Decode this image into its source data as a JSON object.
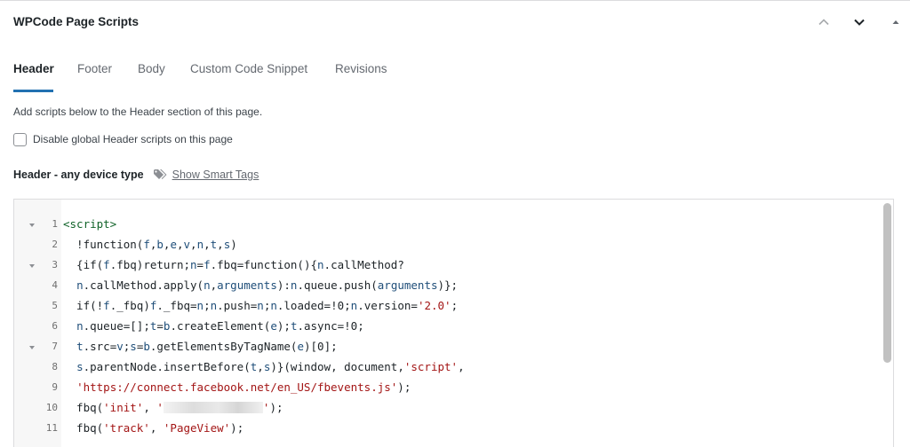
{
  "panel": {
    "title": "WPCode Page Scripts"
  },
  "tabs": [
    {
      "label": "Header",
      "active": true
    },
    {
      "label": "Footer",
      "active": false
    },
    {
      "label": "Body",
      "active": false
    },
    {
      "label": "Custom Code Snippet",
      "active": false
    },
    {
      "label": "Revisions",
      "active": false
    }
  ],
  "description": "Add scripts below to the Header section of this page.",
  "disable_checkbox": {
    "label": "Disable global Header scripts on this page",
    "checked": false
  },
  "field": {
    "label": "Header - any device type",
    "smart_tags_link": "Show Smart Tags"
  },
  "icons": {
    "move_up": "chevron-up-icon",
    "move_down": "chevron-down-icon",
    "toggle": "triangle-up-icon",
    "smart_tags": "tag-icon",
    "fold": "fold-arrow-icon"
  },
  "colors": {
    "accent": "#2271b1",
    "string": "#a31515",
    "tag": "#116329",
    "variable": "#1f4e79"
  },
  "editor": {
    "lines": [
      {
        "n": "1",
        "fold": true,
        "tokens": [
          {
            "t": "<script>",
            "c": "tag"
          }
        ]
      },
      {
        "n": "2",
        "fold": false,
        "tokens": [
          {
            "t": "  !function("
          },
          {
            "t": "f",
            "c": "var"
          },
          {
            "t": ","
          },
          {
            "t": "b",
            "c": "var"
          },
          {
            "t": ","
          },
          {
            "t": "e",
            "c": "var"
          },
          {
            "t": ","
          },
          {
            "t": "v",
            "c": "var"
          },
          {
            "t": ","
          },
          {
            "t": "n",
            "c": "var"
          },
          {
            "t": ","
          },
          {
            "t": "t",
            "c": "var"
          },
          {
            "t": ","
          },
          {
            "t": "s",
            "c": "var"
          },
          {
            "t": ")"
          }
        ]
      },
      {
        "n": "3",
        "fold": true,
        "tokens": [
          {
            "t": "  {if("
          },
          {
            "t": "f",
            "c": "var"
          },
          {
            "t": ".fbq)return;"
          },
          {
            "t": "n",
            "c": "var"
          },
          {
            "t": "="
          },
          {
            "t": "f",
            "c": "var"
          },
          {
            "t": ".fbq=function(){"
          },
          {
            "t": "n",
            "c": "var"
          },
          {
            "t": ".callMethod?"
          }
        ]
      },
      {
        "n": "4",
        "fold": false,
        "tokens": [
          {
            "t": "  "
          },
          {
            "t": "n",
            "c": "var"
          },
          {
            "t": ".callMethod.apply("
          },
          {
            "t": "n",
            "c": "var"
          },
          {
            "t": ","
          },
          {
            "t": "arguments",
            "c": "var"
          },
          {
            "t": "):"
          },
          {
            "t": "n",
            "c": "var"
          },
          {
            "t": ".queue.push("
          },
          {
            "t": "arguments",
            "c": "var"
          },
          {
            "t": ")};"
          }
        ]
      },
      {
        "n": "5",
        "fold": false,
        "tokens": [
          {
            "t": "  if(!"
          },
          {
            "t": "f",
            "c": "var"
          },
          {
            "t": "._fbq)"
          },
          {
            "t": "f",
            "c": "var"
          },
          {
            "t": "._fbq="
          },
          {
            "t": "n",
            "c": "var"
          },
          {
            "t": ";"
          },
          {
            "t": "n",
            "c": "var"
          },
          {
            "t": ".push="
          },
          {
            "t": "n",
            "c": "var"
          },
          {
            "t": ";"
          },
          {
            "t": "n",
            "c": "var"
          },
          {
            "t": ".loaded=!0;"
          },
          {
            "t": "n",
            "c": "var"
          },
          {
            "t": ".version="
          },
          {
            "t": "'2.0'",
            "c": "str"
          },
          {
            "t": ";"
          }
        ]
      },
      {
        "n": "6",
        "fold": false,
        "tokens": [
          {
            "t": "  "
          },
          {
            "t": "n",
            "c": "var"
          },
          {
            "t": ".queue=[];"
          },
          {
            "t": "t",
            "c": "var"
          },
          {
            "t": "="
          },
          {
            "t": "b",
            "c": "var"
          },
          {
            "t": ".createElement("
          },
          {
            "t": "e",
            "c": "var"
          },
          {
            "t": ");"
          },
          {
            "t": "t",
            "c": "var"
          },
          {
            "t": ".async=!0;"
          }
        ]
      },
      {
        "n": "7",
        "fold": true,
        "tokens": [
          {
            "t": "  "
          },
          {
            "t": "t",
            "c": "var"
          },
          {
            "t": ".src="
          },
          {
            "t": "v",
            "c": "var"
          },
          {
            "t": ";"
          },
          {
            "t": "s",
            "c": "var"
          },
          {
            "t": "="
          },
          {
            "t": "b",
            "c": "var"
          },
          {
            "t": ".getElementsByTagName("
          },
          {
            "t": "e",
            "c": "var"
          },
          {
            "t": ")[0];"
          }
        ]
      },
      {
        "n": "8",
        "fold": false,
        "tokens": [
          {
            "t": "  "
          },
          {
            "t": "s",
            "c": "var"
          },
          {
            "t": ".parentNode.insertBefore("
          },
          {
            "t": "t",
            "c": "var"
          },
          {
            "t": ","
          },
          {
            "t": "s",
            "c": "var"
          },
          {
            "t": ")}(window, document,"
          },
          {
            "t": "'script'",
            "c": "str"
          },
          {
            "t": ","
          }
        ]
      },
      {
        "n": "9",
        "fold": false,
        "tokens": [
          {
            "t": "  "
          },
          {
            "t": "'https://connect.facebook.net/en_US/fbevents.js'",
            "c": "str"
          },
          {
            "t": ");"
          }
        ]
      },
      {
        "n": "10",
        "fold": false,
        "tokens": [
          {
            "t": "  fbq("
          },
          {
            "t": "'init'",
            "c": "str"
          },
          {
            "t": ", "
          },
          {
            "t": "'",
            "c": "str"
          },
          {
            "redacted": true
          },
          {
            "t": "'",
            "c": "str"
          },
          {
            "t": ");"
          }
        ]
      },
      {
        "n": "11",
        "fold": false,
        "tokens": [
          {
            "t": "  fbq("
          },
          {
            "t": "'track'",
            "c": "str"
          },
          {
            "t": ", "
          },
          {
            "t": "'PageView'",
            "c": "str"
          },
          {
            "t": ");"
          }
        ]
      }
    ]
  }
}
